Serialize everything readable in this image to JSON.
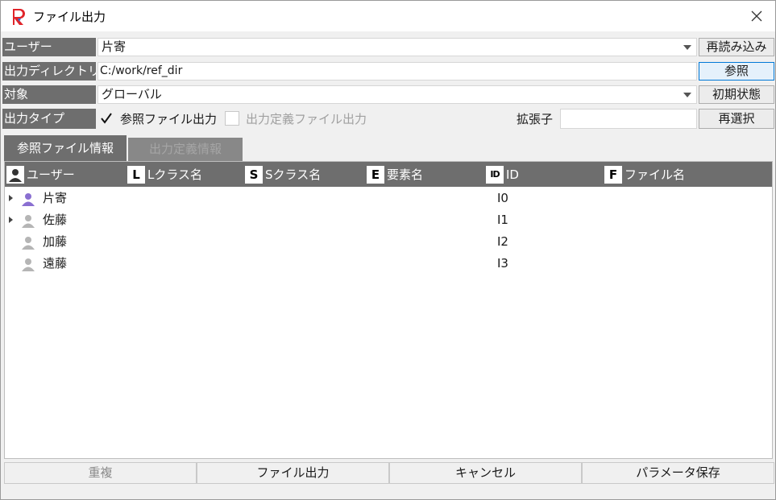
{
  "window": {
    "title": "ファイル出力"
  },
  "form": {
    "user": {
      "label": "ユーザー",
      "value": "片寄",
      "button": "再読み込み"
    },
    "output_dir": {
      "label": "出力ディレクトリ",
      "value": "C:/work/ref_dir",
      "button": "参照"
    },
    "target": {
      "label": "対象",
      "value": "グローバル",
      "button": "初期状態"
    },
    "output_type": {
      "label": "出力タイプ",
      "option1": "参照ファイル出力",
      "option1_checked": true,
      "option2": "出力定義ファイル出力",
      "option2_checked": false,
      "ext_label": "拡張子",
      "ext_value": "",
      "button": "再選択"
    }
  },
  "tabs": [
    {
      "label": "参照ファイル情報",
      "active": true
    },
    {
      "label": "出力定義情報",
      "active": false
    }
  ],
  "list": {
    "columns": [
      {
        "icon": "user-icon",
        "label": "ユーザー"
      },
      {
        "icon": "L",
        "label": "Lクラス名"
      },
      {
        "icon": "S",
        "label": "Sクラス名"
      },
      {
        "icon": "E",
        "label": "要素名"
      },
      {
        "icon": "ID",
        "label": "ID"
      },
      {
        "icon": "F",
        "label": "ファイル名"
      }
    ],
    "rows": [
      {
        "name": "片寄",
        "id": "I0",
        "expandable": true,
        "icon_color": "#8a6fd1"
      },
      {
        "name": "佐藤",
        "id": "I1",
        "expandable": true,
        "icon_color": "#b5b5b5"
      },
      {
        "name": "加藤",
        "id": "I2",
        "expandable": false,
        "icon_color": "#b5b5b5"
      },
      {
        "name": "遠藤",
        "id": "I3",
        "expandable": false,
        "icon_color": "#b5b5b5"
      }
    ]
  },
  "buttons": {
    "duplicate": "重複",
    "file_output": "ファイル出力",
    "cancel": "キャンセル",
    "save_params": "パラメータ保存"
  },
  "colors": {
    "brand_red": "#e0242a",
    "header_gray": "#6e6e6e",
    "active_user": "#8a6fd1"
  }
}
